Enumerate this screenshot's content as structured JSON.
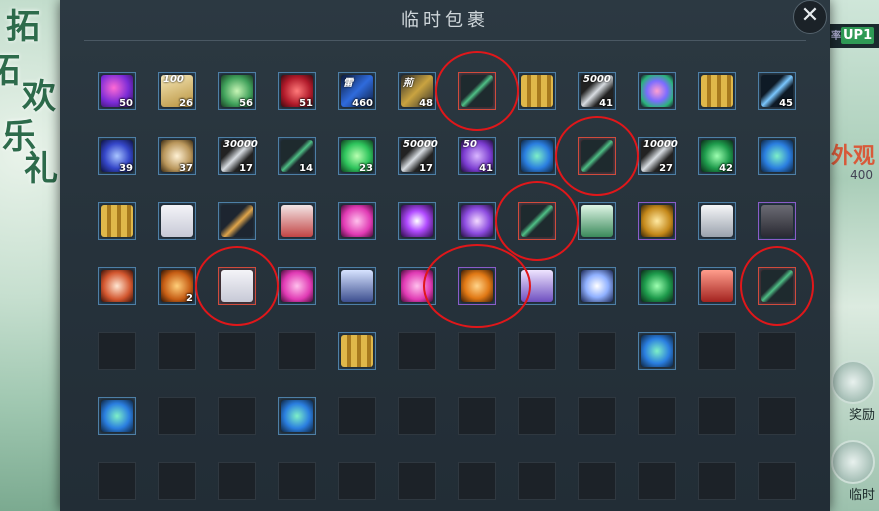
{
  "window": {
    "title": "临时包裹",
    "close_label": "✕"
  },
  "left_banner": {
    "chars": [
      "拓",
      "拓",
      "欢",
      "乐",
      "礼"
    ]
  },
  "right_side": {
    "badge_prefix": "率",
    "badge_up": "UP1",
    "label": "外观",
    "count": "400",
    "button_1": "奖励",
    "button_2": "临时"
  },
  "colors": {
    "circle": "#e0171a",
    "slot_blue": "#4d7fa6",
    "slot_red": "#d14b3c",
    "slot_purple": "#8a5cc9"
  },
  "rows": [
    [
      {
        "icon": "purple-orb",
        "count": "50"
      },
      {
        "icon": "gold-box",
        "tag": "100",
        "count": "26"
      },
      {
        "icon": "green-orb",
        "count": "56"
      },
      {
        "icon": "red-orb",
        "count": "51"
      },
      {
        "icon": "blue-crystal",
        "tag": "雷",
        "count": "460"
      },
      {
        "icon": "gold-scroll",
        "tag": "荊",
        "count": "48"
      },
      {
        "icon": "green-spear",
        "count": "",
        "style": "red"
      },
      {
        "icon": "gold-chest",
        "count": ""
      },
      {
        "icon": "silver-bar",
        "tag": "5000",
        "count": "41"
      },
      {
        "icon": "gem-cluster",
        "count": ""
      },
      {
        "icon": "gold-chest",
        "count": ""
      },
      {
        "icon": "blue-ribbon",
        "count": "45"
      }
    ],
    [
      {
        "icon": "blue-swirl",
        "count": "39"
      },
      {
        "icon": "pearl",
        "count": "37"
      },
      {
        "icon": "silver-bar",
        "tag": "30000",
        "count": "17"
      },
      {
        "icon": "green-spear",
        "count": "14"
      },
      {
        "icon": "green-gem",
        "count": "23"
      },
      {
        "icon": "silver-bar",
        "tag": "50000",
        "count": "17"
      },
      {
        "icon": "purple-ball",
        "tag": "50",
        "count": "41"
      },
      {
        "icon": "blue-gems",
        "count": ""
      },
      {
        "icon": "green-spear",
        "count": "",
        "style": "red"
      },
      {
        "icon": "silver-bar",
        "tag": "10000",
        "count": "27"
      },
      {
        "icon": "green-coins",
        "count": "42"
      },
      {
        "icon": "blue-gems",
        "count": ""
      }
    ],
    [
      {
        "icon": "gold-chest",
        "count": ""
      },
      {
        "icon": "white-robe",
        "count": ""
      },
      {
        "icon": "fan-broom",
        "count": ""
      },
      {
        "icon": "red-robe",
        "count": ""
      },
      {
        "icon": "pink-blob",
        "count": ""
      },
      {
        "icon": "purple-star",
        "count": ""
      },
      {
        "icon": "purple-butterfly",
        "count": ""
      },
      {
        "icon": "green-spear",
        "count": "",
        "style": "red"
      },
      {
        "icon": "green-robe",
        "count": ""
      },
      {
        "icon": "gold-orb",
        "count": "",
        "style": "purple"
      },
      {
        "icon": "white-armor",
        "count": ""
      },
      {
        "icon": "dark-armor",
        "count": "",
        "style": "purple"
      }
    ],
    [
      {
        "icon": "gift-sack",
        "count": ""
      },
      {
        "icon": "orange-pot",
        "count": "2"
      },
      {
        "icon": "white-robe",
        "count": "",
        "style": "red"
      },
      {
        "icon": "pink-blob",
        "count": ""
      },
      {
        "icon": "blue-armor",
        "count": ""
      },
      {
        "icon": "pink-blob",
        "count": ""
      },
      {
        "icon": "orange-balls",
        "count": "",
        "style": "purple"
      },
      {
        "icon": "purple-robe",
        "count": ""
      },
      {
        "icon": "moon-vase",
        "count": ""
      },
      {
        "icon": "green-coins",
        "count": ""
      },
      {
        "icon": "red-armor",
        "count": ""
      },
      {
        "icon": "green-spear",
        "count": "",
        "style": "red"
      }
    ],
    [
      {
        "icon": "empty"
      },
      {
        "icon": "empty"
      },
      {
        "icon": "empty"
      },
      {
        "icon": "empty"
      },
      {
        "icon": "gold-chest",
        "count": ""
      },
      {
        "icon": "empty"
      },
      {
        "icon": "empty"
      },
      {
        "icon": "empty"
      },
      {
        "icon": "empty"
      },
      {
        "icon": "blue-gems",
        "count": ""
      },
      {
        "icon": "empty"
      },
      {
        "icon": "empty"
      }
    ],
    [
      {
        "icon": "blue-gems",
        "count": ""
      },
      {
        "icon": "empty"
      },
      {
        "icon": "empty"
      },
      {
        "icon": "blue-gems",
        "count": ""
      },
      {
        "icon": "empty"
      },
      {
        "icon": "empty"
      },
      {
        "icon": "empty"
      },
      {
        "icon": "empty"
      },
      {
        "icon": "empty"
      },
      {
        "icon": "empty"
      },
      {
        "icon": "empty"
      },
      {
        "icon": "empty"
      }
    ],
    [
      {
        "icon": "empty"
      },
      {
        "icon": "empty"
      },
      {
        "icon": "empty"
      },
      {
        "icon": "empty"
      },
      {
        "icon": "empty"
      },
      {
        "icon": "empty"
      },
      {
        "icon": "empty"
      },
      {
        "icon": "empty"
      },
      {
        "icon": "empty"
      },
      {
        "icon": "empty"
      },
      {
        "icon": "empty"
      },
      {
        "icon": "empty"
      }
    ]
  ],
  "highlight_circles": [
    {
      "row": 0,
      "col": 6
    },
    {
      "row": 1,
      "col": 8
    },
    {
      "row": 2,
      "col": 7
    },
    {
      "row": 3,
      "col": 2
    },
    {
      "row": 3,
      "col": 6
    },
    {
      "row": 3,
      "col": 11
    }
  ]
}
